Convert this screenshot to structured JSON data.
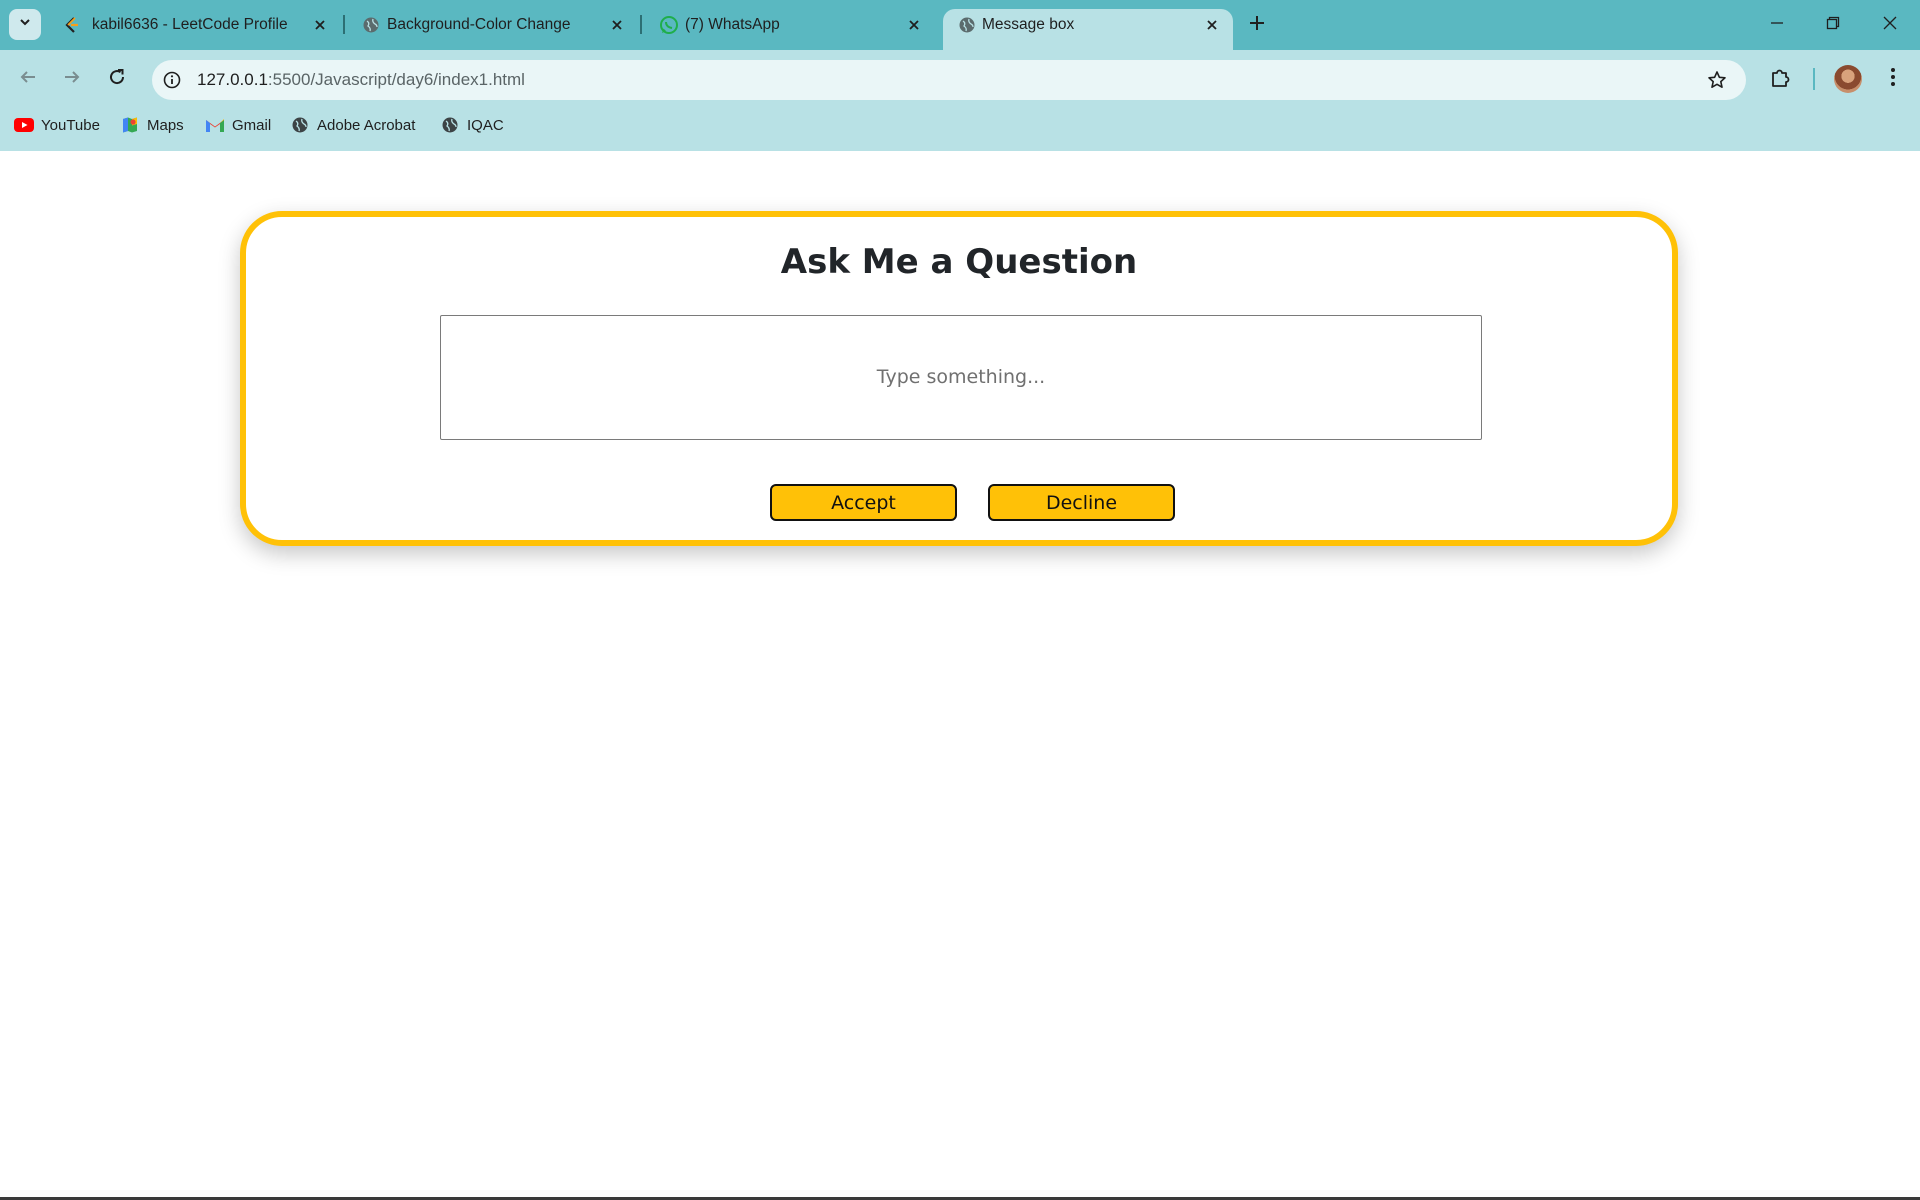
{
  "browser": {
    "tabs": [
      {
        "title": "kabil6636 - LeetCode Profile",
        "icon": "leetcode-icon"
      },
      {
        "title": "Background-Color Change",
        "icon": "globe-icon"
      },
      {
        "title": "(7) WhatsApp",
        "icon": "whatsapp-icon"
      },
      {
        "title": "Message box",
        "icon": "globe-icon",
        "active": true
      }
    ],
    "address": {
      "host": "127.0.0.1",
      "path": ":5500/Javascript/day6/index1.html"
    },
    "bookmarks": [
      {
        "label": "YouTube",
        "icon": "youtube-icon"
      },
      {
        "label": "Maps",
        "icon": "maps-icon"
      },
      {
        "label": "Gmail",
        "icon": "gmail-icon"
      },
      {
        "label": "Adobe Acrobat",
        "icon": "globe-icon"
      },
      {
        "label": "IQAC",
        "icon": "globe-icon"
      }
    ],
    "colors": {
      "tabstrip": "#5ab8c1",
      "toolbar": "#b8e1e5"
    }
  },
  "page": {
    "heading": "Ask Me a Question",
    "input": {
      "placeholder": "Type something...",
      "value": ""
    },
    "accept_label": "Accept",
    "decline_label": "Decline",
    "colors": {
      "accent": "#ffc107",
      "text": "#212529"
    }
  }
}
